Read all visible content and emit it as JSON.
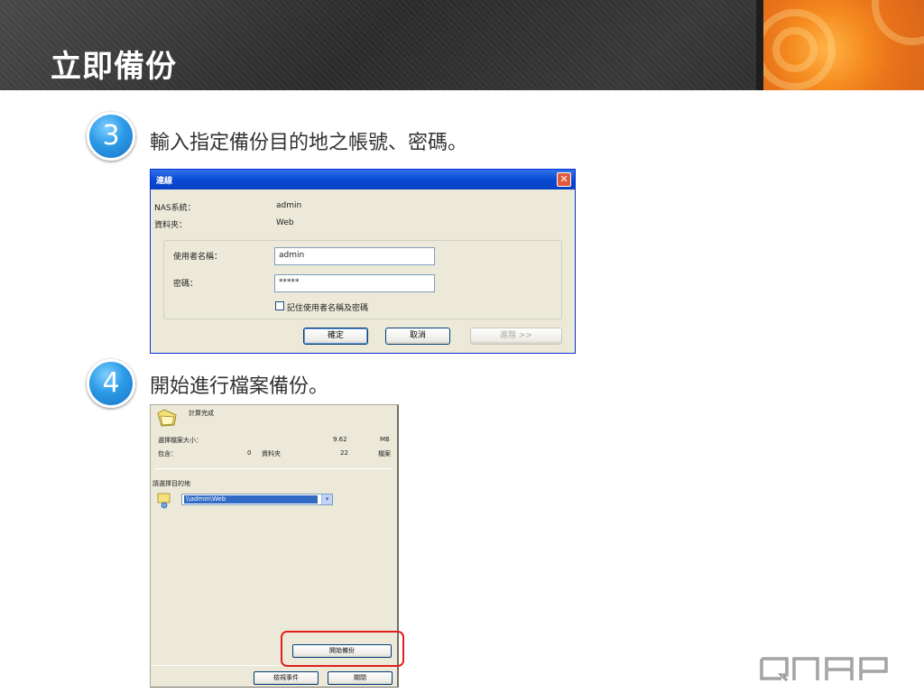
{
  "header": {
    "title": "立即備份"
  },
  "steps": [
    {
      "number": "3",
      "text": "輸入指定備份目的地之帳號、密碼。"
    },
    {
      "number": "4",
      "text": "開始進行檔案備份。"
    }
  ],
  "connect_dialog": {
    "title": "連線",
    "close_symbol": "✕",
    "nas_label": "NAS系統：",
    "nas_value": "admin",
    "folder_label": "資料夾：",
    "folder_value": "Web",
    "username_label": "使用者名稱：",
    "username_value": "admin",
    "password_label": "密碼：",
    "password_value": "*****",
    "remember_label": "記住使用者名稱及密碼",
    "ok_label": "確定",
    "cancel_label": "取消",
    "advanced_label": "進階 >>"
  },
  "backup_dialog": {
    "status_text": "計算完成",
    "size_label": "選擇檔案大小：",
    "size_value": "9.62",
    "size_unit": "MB",
    "contains_label": "包含：",
    "folder_count": "0",
    "folder_unit": "資料夾",
    "file_count": "22",
    "file_unit": "檔案",
    "destination_label": "請選擇目的地",
    "destination_value": "\\\\admin\\Web",
    "start_backup_label": "開始備份",
    "view_events_label": "檢視事件",
    "close_label": "關閉"
  },
  "brand": {
    "logo_text": "QNAP"
  },
  "colors": {
    "accent_orange": "#f58b1f",
    "highlight_red": "#e0201c",
    "xp_blue": "#0a4bd4"
  }
}
